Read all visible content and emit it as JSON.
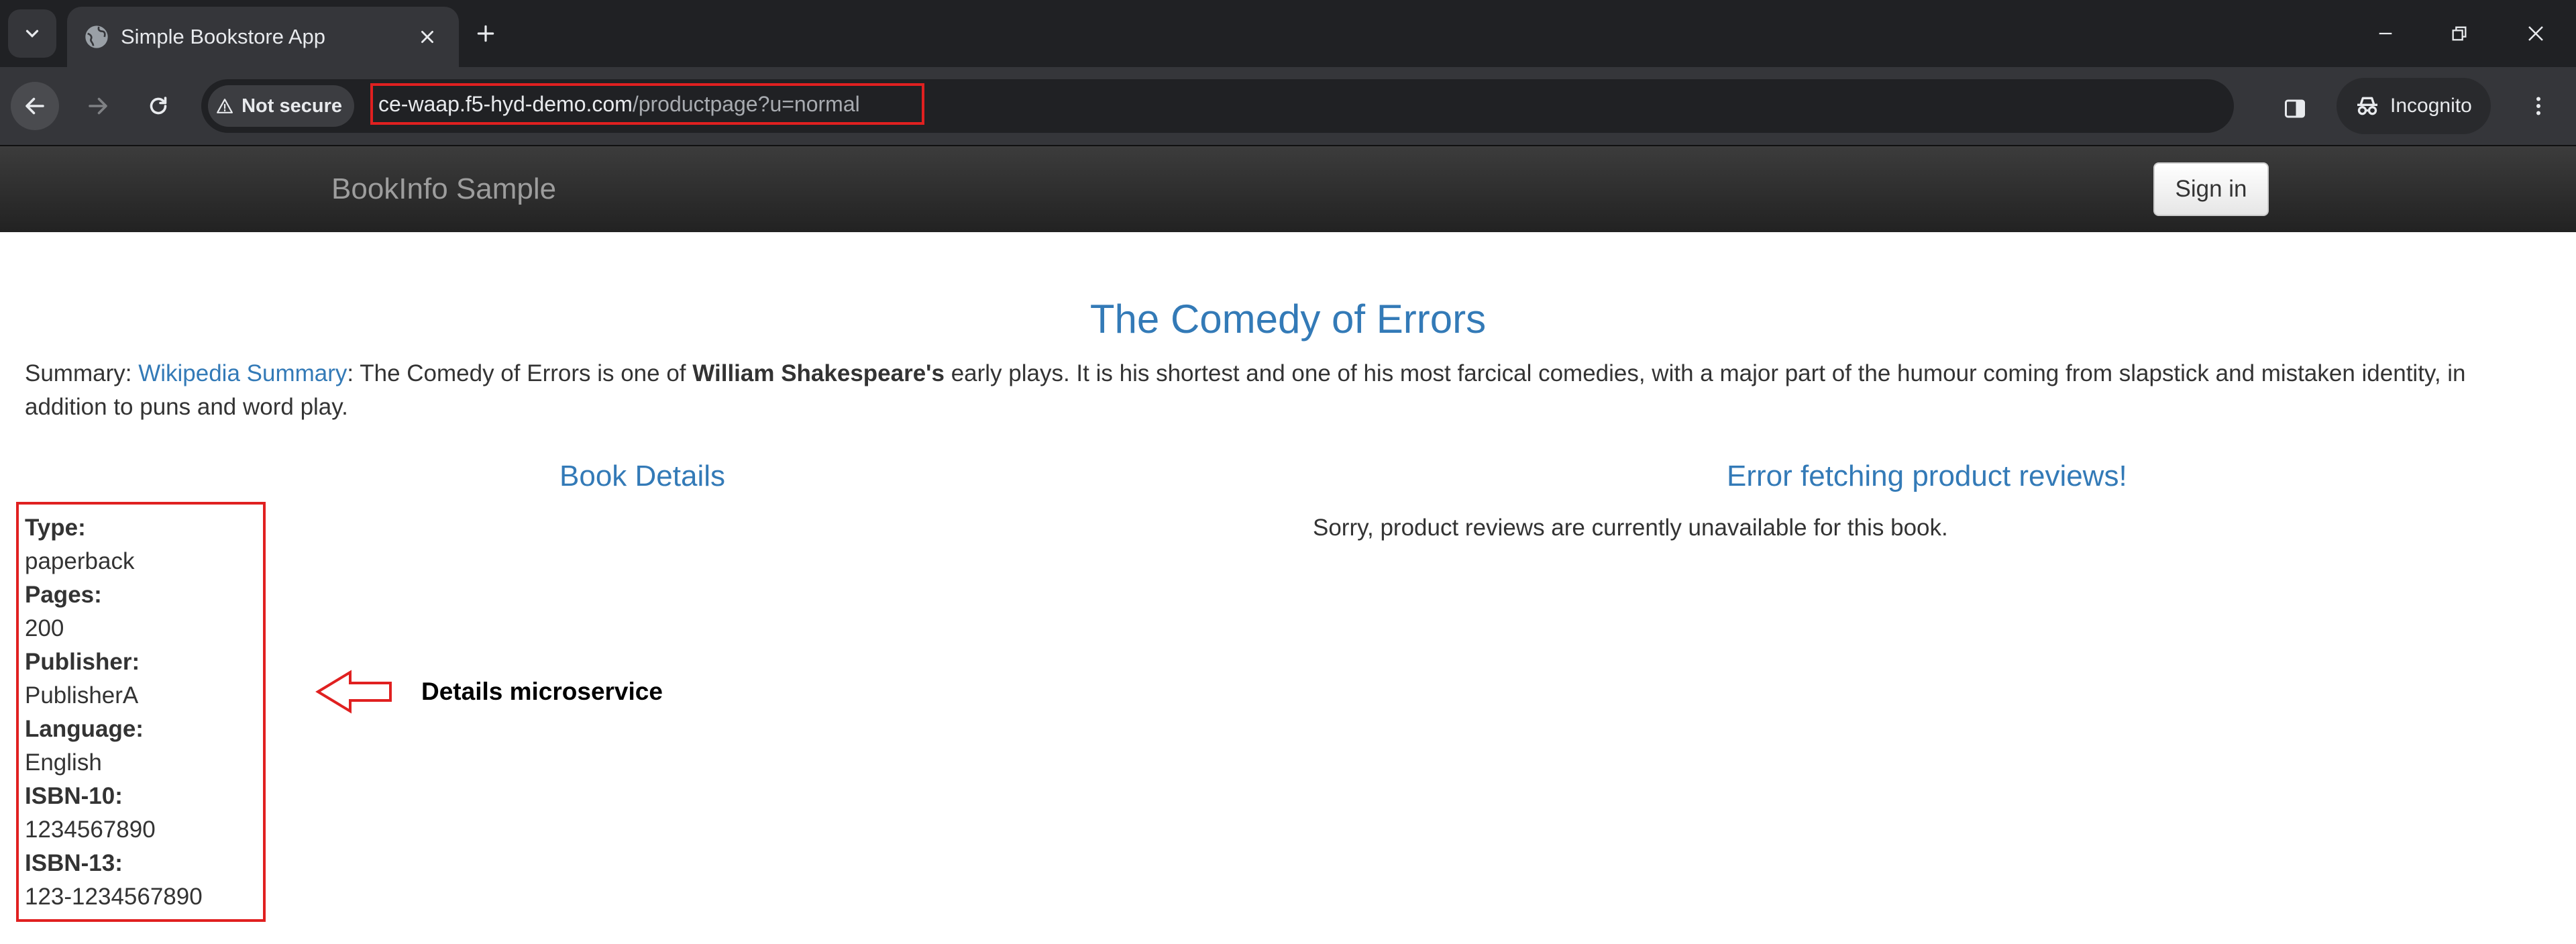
{
  "browser": {
    "tab_title": "Simple Bookstore App",
    "security_label": "Not secure",
    "url_host": "ce-waap.f5-hyd-demo.com",
    "url_path": "/productpage?u=normal",
    "profile_label": "Incognito"
  },
  "navbar": {
    "brand": "BookInfo Sample",
    "signin_label": "Sign in"
  },
  "book": {
    "title": "The Comedy of Errors",
    "summary_prefix": "Summary: ",
    "summary_link": "Wikipedia Summary",
    "summary_text_1": ": The Comedy of Errors is one of ",
    "summary_bold": "William Shakespeare's",
    "summary_text_2": " early plays. It is his shortest and one of his most farcical comedies, with a major part of the humour coming from slapstick and mistaken identity, in addition to puns and word play."
  },
  "details": {
    "heading": "Book Details",
    "fields": [
      {
        "label": "Type:",
        "value": "paperback"
      },
      {
        "label": "Pages:",
        "value": "200"
      },
      {
        "label": "Publisher:",
        "value": "PublisherA"
      },
      {
        "label": "Language:",
        "value": "English"
      },
      {
        "label": "ISBN-10:",
        "value": "1234567890"
      },
      {
        "label": "ISBN-13:",
        "value": "123-1234567890"
      }
    ]
  },
  "reviews": {
    "heading": "Error fetching product reviews!",
    "message": "Sorry, product reviews are currently unavailable for this book."
  },
  "annotation": {
    "text": "Details microservice"
  },
  "colors": {
    "link_blue": "#337ab7",
    "highlight_red": "#e02020",
    "navbar_dark": "#222222"
  }
}
